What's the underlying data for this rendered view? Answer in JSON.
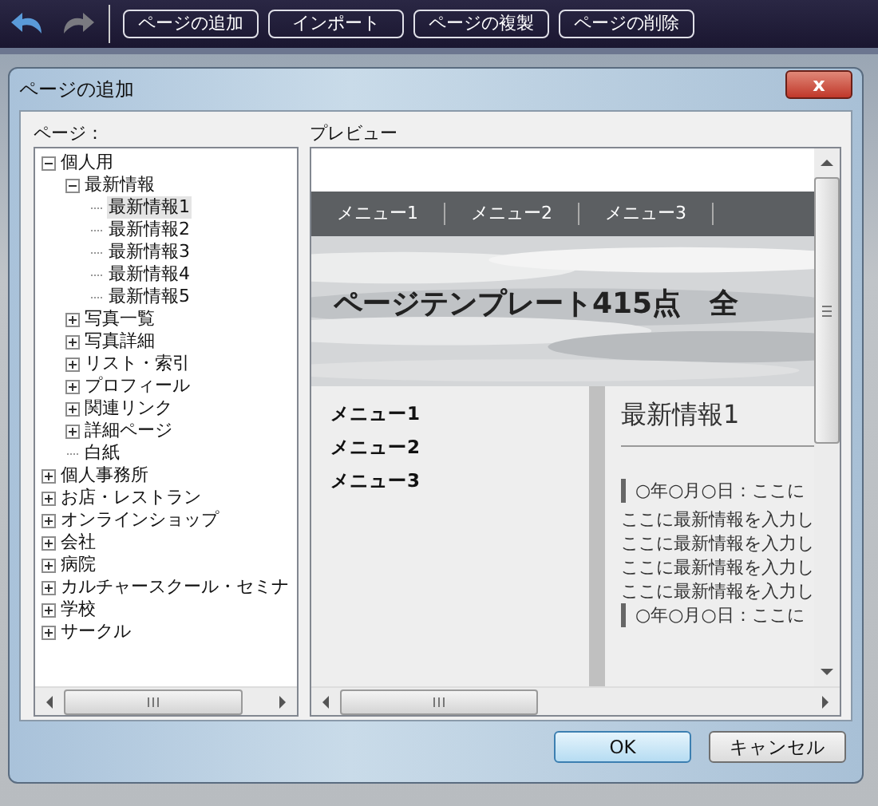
{
  "toolbar": {
    "buttons": [
      "ページの追加",
      "インポート",
      "ページの複製",
      "ページの削除"
    ]
  },
  "dialog": {
    "title": "ページの追加",
    "close": "x"
  },
  "tree": {
    "label": "ページ：",
    "items": [
      {
        "label": "個人用",
        "expanded": true,
        "selected": false,
        "children": [
          {
            "label": "最新情報",
            "expanded": true,
            "selected": false,
            "children": [
              {
                "label": "最新情報1",
                "selected": true
              },
              {
                "label": "最新情報2",
                "selected": false
              },
              {
                "label": "最新情報3",
                "selected": false
              },
              {
                "label": "最新情報4",
                "selected": false
              },
              {
                "label": "最新情報5",
                "selected": false
              }
            ]
          },
          {
            "label": "写真一覧",
            "expanded": false,
            "selected": false
          },
          {
            "label": "写真詳細",
            "expanded": false,
            "selected": false
          },
          {
            "label": "リスト・索引",
            "expanded": false,
            "selected": false
          },
          {
            "label": "プロフィール",
            "expanded": false,
            "selected": false
          },
          {
            "label": "関連リンク",
            "expanded": false,
            "selected": false
          },
          {
            "label": "詳細ページ",
            "expanded": false,
            "selected": false
          },
          {
            "label": "白紙",
            "selected": false
          }
        ]
      },
      {
        "label": "個人事務所",
        "expanded": false,
        "selected": false
      },
      {
        "label": "お店・レストラン",
        "expanded": false,
        "selected": false
      },
      {
        "label": "オンラインショップ",
        "expanded": false,
        "selected": false
      },
      {
        "label": "会社",
        "expanded": false,
        "selected": false
      },
      {
        "label": "病院",
        "expanded": false,
        "selected": false
      },
      {
        "label": "カルチャースクール・セミナ",
        "expanded": false,
        "selected": false
      },
      {
        "label": "学校",
        "expanded": false,
        "selected": false
      },
      {
        "label": "サークル",
        "expanded": false,
        "selected": false
      }
    ]
  },
  "preview": {
    "label": "プレビュー",
    "nav": [
      "メニュー1",
      "メニュー2",
      "メニュー3"
    ],
    "banner_title": "ページテンプレート415点　全",
    "side_menu": [
      "メニュー1",
      "メニュー2",
      "メニュー3"
    ],
    "heading": "最新情報1",
    "entries": [
      {
        "date": "○年○月○日：ここに",
        "lines": [
          "ここに最新情報を入力し",
          "ここに最新情報を入力し",
          "ここに最新情報を入力し",
          "ここに最新情報を入力し"
        ]
      },
      {
        "date": "○年○月○日：ここに"
      }
    ]
  },
  "buttons": [
    {
      "label": "OK",
      "default": true
    },
    {
      "label": "キャンセル",
      "default": false
    }
  ]
}
